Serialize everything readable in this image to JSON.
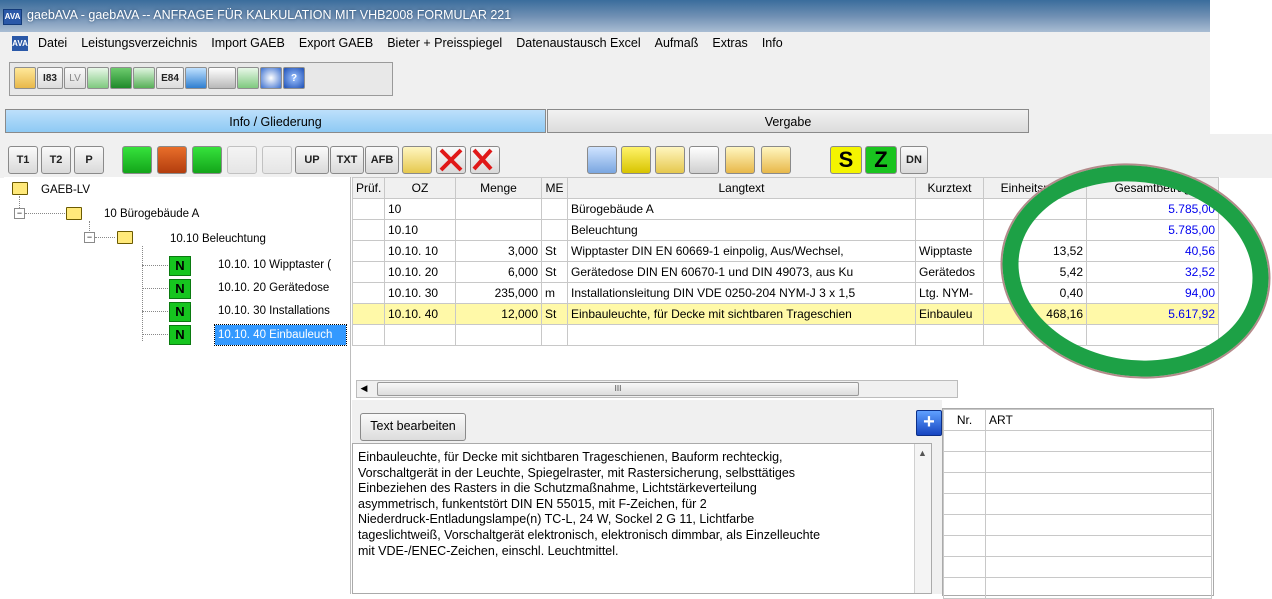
{
  "window": {
    "app_icon": "AVA",
    "title": "gaebAVA - gaebAVA  -- ANFRAGE FÜR KALKULATION  MIT VHB2008 FORMULAR 221"
  },
  "menu": [
    "Datei",
    "Leistungsverzeichnis",
    "Import GAEB",
    "Export GAEB",
    "Bieter + Preisspiegel",
    "Datenaustausch Excel",
    "Aufmaß",
    "Extras",
    "Info"
  ],
  "toolbar": {
    "btn_i83": "I83",
    "btn_lv": "LV",
    "btn_e84": "E84"
  },
  "tabs": {
    "info": "Info / Gliederung",
    "vergabe": "Vergabe"
  },
  "toolbar2": {
    "t1": "T1",
    "t2": "T2",
    "p": "P",
    "up": "UP",
    "txt": "TXT",
    "afb": "AFB",
    "s": "S",
    "z": "Z",
    "dn": "DN"
  },
  "tree": {
    "root": "GAEB-LV",
    "lvl1": "10 Bürogebäude A",
    "lvl2": "10.10 Beleuchtung",
    "badge": "N",
    "items": [
      "10.10.  10 Wipptaster (",
      "10.10.  20 Gerätedose",
      "10.10.  30 Installations",
      "10.10.  40 Einbauleuch"
    ]
  },
  "grid": {
    "headers": [
      "Prüf.",
      "OZ",
      "Menge",
      "ME",
      "Langtext",
      "Kurztext",
      "Einheitspreis",
      "Gesamtbetrag"
    ],
    "rows": [
      [
        "",
        "10",
        "",
        "",
        "Bürogebäude A",
        "",
        "",
        "5.785,00"
      ],
      [
        "",
        "10.10",
        "",
        "",
        "Beleuchtung",
        "",
        "",
        "5.785,00"
      ],
      [
        "",
        "10.10.  10",
        "3,000",
        "St",
        "Wipptaster DIN EN 60669-1 einpolig, Aus/Wechsel, ",
        "Wipptaste",
        "13,52",
        "40,56"
      ],
      [
        "",
        "10.10.  20",
        "6,000",
        "St",
        "Gerätedose DIN EN 60670-1 und DIN 49073, aus Ku",
        "Gerätedos",
        "5,42",
        "32,52"
      ],
      [
        "",
        "10.10.  30",
        "235,000",
        "m",
        "Installationsleitung DIN VDE 0250-204 NYM-J 3 x 1,5",
        "Ltg. NYM-",
        "0,40",
        "94,00"
      ],
      [
        "",
        "10.10.  40",
        "12,000",
        "St",
        "Einbauleuchte, für Decke mit sichtbaren Trageschien",
        "Einbauleu",
        "468,16",
        "5.617,92"
      ]
    ],
    "scroll_grip": "III"
  },
  "text_panel": {
    "edit_button": "Text bearbeiten",
    "lines": [
      "Einbauleuchte, für Decke mit sichtbaren Trageschienen, Bauform rechteckig,",
      "Vorschaltgerät in der Leuchte, Spiegelraster, mit Rastersicherung, selbsttätiges",
      "Einbeziehen des Rasters in die Schutzmaßnahme, Lichtstärkeverteilung",
      "asymmetrisch, funkentstört DIN EN 55015, mit F-Zeichen, für 2",
      "Niederdruck-Entladungslampe(n) TC-L, 24 W, Sockel 2 G 11, Lichtfarbe",
      "tageslichtweiß, Vorschaltgerät elektronisch, elektronisch dimmbar, als Einzelleuchte",
      "mit VDE-/ENEC-Zeichen, einschl. Leuchtmittel."
    ]
  },
  "nr_panel": {
    "headers": [
      "Nr.",
      "ART"
    ]
  },
  "colors": {
    "highlight_oval": "#1da146",
    "selected_row": "#fff9a8",
    "amount_blue": "#0000ee",
    "badge_green": "#16c51f"
  }
}
